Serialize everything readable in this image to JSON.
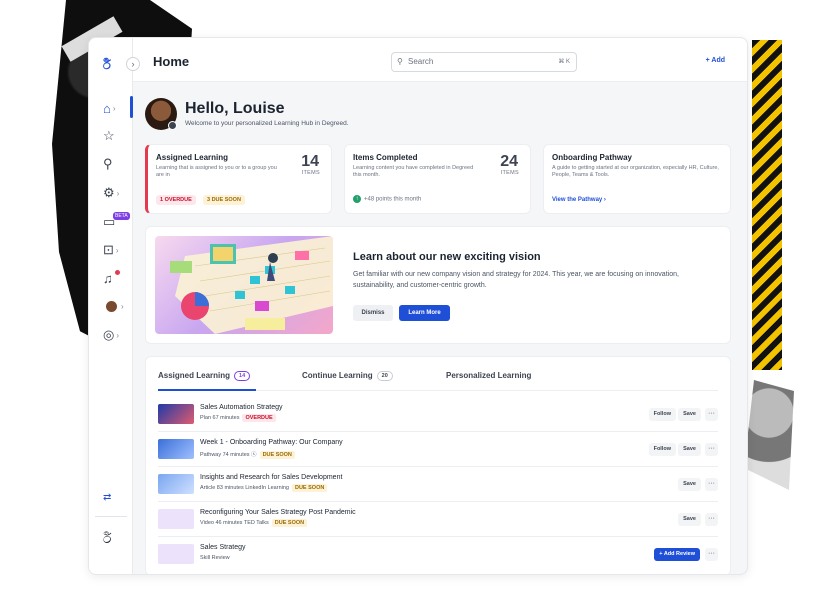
{
  "app": {
    "title": "Home",
    "brand_color": "#1f4fd6"
  },
  "search": {
    "placeholder": "Search",
    "shortcut": "⌘ K"
  },
  "header": {
    "add_label": "+ Add"
  },
  "sidebar": {
    "toggle_icon": "chevron-right-icon",
    "items": [
      {
        "icon": "home-icon",
        "glyph": "⌂"
      },
      {
        "icon": "star-icon",
        "glyph": "☆"
      },
      {
        "icon": "search-icon",
        "glyph": "⌕"
      },
      {
        "icon": "settings-icon",
        "glyph": "⚙"
      },
      {
        "icon": "chat-icon",
        "glyph": "💬",
        "badge": "BETA"
      },
      {
        "icon": "inbox-icon",
        "glyph": "⌂"
      },
      {
        "icon": "bell-icon",
        "glyph": "🔔"
      },
      {
        "icon": "avatar-icon",
        "glyph": ""
      },
      {
        "icon": "globe-icon",
        "glyph": "◎"
      }
    ],
    "swap_icon": "⇄"
  },
  "greeting": {
    "title": "Hello, Louise",
    "subtitle": "Welcome to your personalized Learning Hub in Degreed."
  },
  "cards": {
    "assigned": {
      "title": "Assigned Learning",
      "desc": "Learning that is assigned to you or to a group you are in",
      "count": "14",
      "unit": "ITEMS",
      "overdue": "1 OVERDUE",
      "due_soon": "3 DUE SOON"
    },
    "completed": {
      "title": "Items Completed",
      "desc": "Learning content you have completed in Degreed this month.",
      "count": "24",
      "unit": "ITEMS",
      "points": "+48 points this month"
    },
    "onboarding": {
      "title": "Onboarding Pathway",
      "desc": "A guide to getting started at our organization, especially HR, Culture, People, Teams & Tools.",
      "link": "View the Pathway ›"
    }
  },
  "promo": {
    "title": "Learn about our new exciting vision",
    "desc": "Get familiar with our new company vision and strategy for 2024. This year, we are focusing on innovation, sustainability, and customer-centric growth.",
    "dismiss": "Dismiss",
    "learn_more": "Learn More"
  },
  "tabs": [
    {
      "label": "Assigned Learning",
      "count": "14"
    },
    {
      "label": "Continue Learning",
      "count": "20"
    },
    {
      "label": "Personalized Learning",
      "count": ""
    }
  ],
  "rows": [
    {
      "title": "Sales Automation Strategy",
      "meta": "Plan   67 minutes",
      "tag": "OVERDUE",
      "tag_type": "over",
      "actions": [
        "Follow",
        "Save"
      ],
      "thumb": "#3b5bd6"
    },
    {
      "title": "Week 1 - Onboarding Pathway: Our Company",
      "meta": "Pathway   74 minutes   ⓢ",
      "tag": "DUE SOON",
      "tag_type": "due",
      "actions": [
        "Follow",
        "Save"
      ],
      "thumb": "#6e8ef0"
    },
    {
      "title": "Insights and Research for Sales Development",
      "meta": "Article   83 minutes   LinkedIn Learning",
      "tag": "DUE SOON",
      "tag_type": "due",
      "actions": [
        "Save"
      ],
      "thumb": "#8fb0f5"
    },
    {
      "title": "Reconfiguring Your Sales Strategy Post Pandemic",
      "meta": "Video   46 minutes   TED Talks",
      "tag": "DUE SOON",
      "tag_type": "due",
      "actions": [
        "Save"
      ],
      "thumb": "#e7dcf8"
    },
    {
      "title": "Sales Strategy",
      "meta": "Skill Review",
      "tag": "",
      "tag_type": "",
      "actions": [],
      "review": "+ Add Review",
      "thumb": "#e7dcf8"
    }
  ],
  "more_glyph": "···"
}
